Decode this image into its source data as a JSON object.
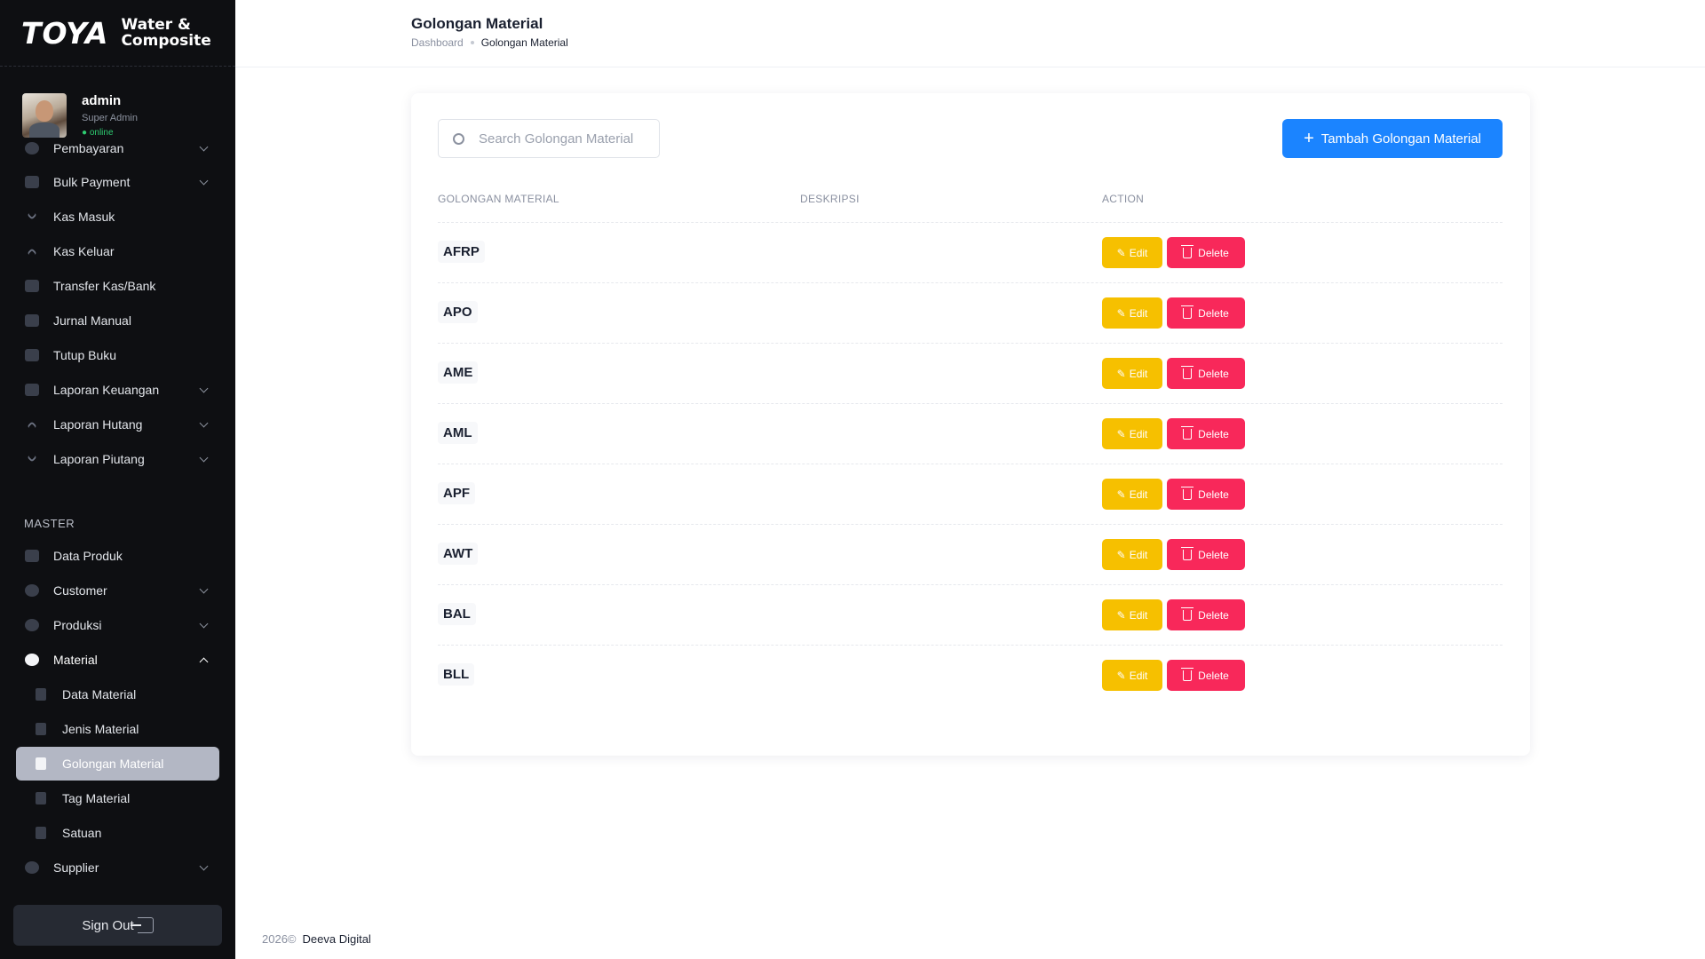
{
  "brand": {
    "logo": "TOYA",
    "subtitle_line1": "Water &",
    "subtitle_line2": "Composite"
  },
  "user": {
    "name": "admin",
    "role": "Super Admin",
    "status": "● online"
  },
  "sidebar": {
    "items": [
      {
        "label": "Pembayaran",
        "has_caret": true
      },
      {
        "label": "Bulk Payment",
        "has_caret": true
      },
      {
        "label": "Kas Masuk",
        "has_caret": false
      },
      {
        "label": "Kas Keluar",
        "has_caret": false
      },
      {
        "label": "Transfer Kas/Bank",
        "has_caret": false
      },
      {
        "label": "Jurnal Manual",
        "has_caret": false
      },
      {
        "label": "Tutup Buku",
        "has_caret": false
      },
      {
        "label": "Laporan Keuangan",
        "has_caret": true
      },
      {
        "label": "Laporan Hutang",
        "has_caret": true
      },
      {
        "label": "Laporan Piutang",
        "has_caret": true
      }
    ],
    "section_master": "MASTER",
    "master_items": [
      {
        "label": "Data Produk"
      },
      {
        "label": "Customer"
      },
      {
        "label": "Produksi"
      },
      {
        "label": "Material"
      }
    ],
    "material_sub": [
      {
        "label": "Data Material"
      },
      {
        "label": "Jenis Material"
      },
      {
        "label": "Golongan Material"
      },
      {
        "label": "Tag Material"
      },
      {
        "label": "Satuan"
      }
    ],
    "supplier": "Supplier",
    "sign_out": "Sign Out"
  },
  "header": {
    "title": "Golongan Material",
    "breadcrumb_home": "Dashboard",
    "breadcrumb_current": "Golongan Material"
  },
  "toolbar": {
    "search_placeholder": "Search Golongan Material",
    "add_label": "Tambah Golongan Material"
  },
  "table": {
    "headers": [
      "GOLONGAN MATERIAL",
      "DESKRIPSI",
      "ACTION"
    ],
    "rows": [
      {
        "code": "AFRP",
        "description": ""
      },
      {
        "code": "APO",
        "description": ""
      },
      {
        "code": "AME",
        "description": ""
      },
      {
        "code": "AML",
        "description": ""
      },
      {
        "code": "APF",
        "description": ""
      },
      {
        "code": "AWT",
        "description": ""
      },
      {
        "code": "BAL",
        "description": ""
      },
      {
        "code": "BLL",
        "description": ""
      }
    ],
    "edit_label": "Edit",
    "delete_label": "Delete"
  },
  "footer": {
    "year": "2026©",
    "company": "Deeva Digital"
  },
  "colors": {
    "primary": "#1b84ff",
    "warning": "#f6c000",
    "danger": "#f8285a",
    "sidebar": "#0e0f12"
  }
}
